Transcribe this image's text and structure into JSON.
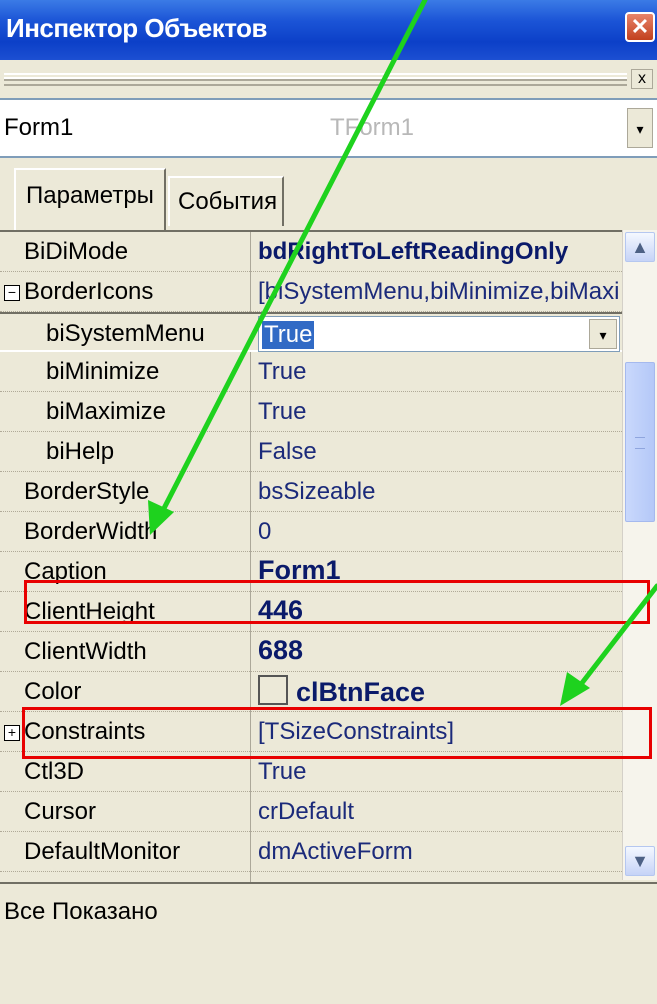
{
  "window": {
    "title": "Инспектор Объектов",
    "close_symbol": "✕"
  },
  "dockbar": {
    "close_symbol": "x"
  },
  "object_selector": {
    "name": "Form1",
    "type": "TForm1",
    "dropdown_symbol": "▾"
  },
  "tabs": [
    {
      "label": "Параметры",
      "active": true
    },
    {
      "label": "События",
      "active": false
    }
  ],
  "properties": [
    {
      "name": "BiDiMode",
      "value": "bdRightToLeftReadingOnly",
      "bold": true,
      "indent": 0
    },
    {
      "name": "BorderIcons",
      "value": "[biSystemMenu,biMinimize,biMaximize]",
      "expander": "minus",
      "indent": 0
    },
    {
      "name": "biSystemMenu",
      "value": "True",
      "indent": 1,
      "editing": true
    },
    {
      "name": "biMinimize",
      "value": "True",
      "indent": 1
    },
    {
      "name": "biMaximize",
      "value": "True",
      "indent": 1
    },
    {
      "name": "biHelp",
      "value": "False",
      "indent": 1
    },
    {
      "name": "BorderStyle",
      "value": "bsSizeable",
      "indent": 0
    },
    {
      "name": "BorderWidth",
      "value": "0",
      "indent": 0
    },
    {
      "name": "Caption",
      "value": "Form1",
      "bold": true,
      "indent": 0
    },
    {
      "name": "ClientHeight",
      "value": "446",
      "bold": true,
      "indent": 0
    },
    {
      "name": "ClientWidth",
      "value": "688",
      "bold": true,
      "indent": 0
    },
    {
      "name": "Color",
      "value": "clBtnFace",
      "bold": true,
      "swatch": true,
      "indent": 0
    },
    {
      "name": "Constraints",
      "value": "[TSizeConstraints]",
      "expander": "plus",
      "indent": 0
    },
    {
      "name": "Ctl3D",
      "value": "True",
      "indent": 0
    },
    {
      "name": "Cursor",
      "value": "crDefault",
      "indent": 0
    },
    {
      "name": "DefaultMonitor",
      "value": "dmActiveForm",
      "indent": 0
    }
  ],
  "status": {
    "text": "Все Показано"
  },
  "scrollbar": {
    "up_symbol": "▲",
    "down_symbol": "▼"
  },
  "colors": {
    "highlight_box": "#e80000",
    "arrow": "#1ed21e",
    "selection": "#316ac5"
  }
}
